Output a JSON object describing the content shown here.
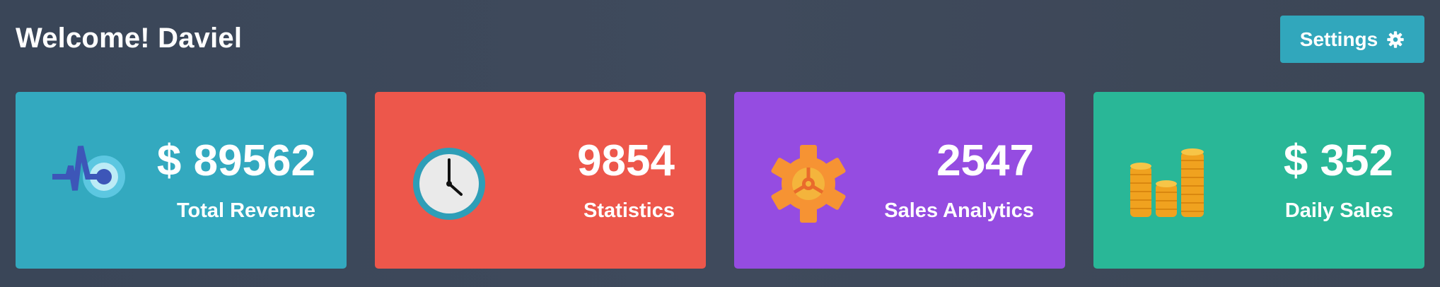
{
  "header": {
    "welcome_text": "Welcome! Daviel",
    "settings_label": "Settings",
    "settings_icon": "gear-icon"
  },
  "cards": [
    {
      "value": "$ 89562",
      "label": "Total Revenue",
      "icon": "pulse-target-icon",
      "color": "#33a9bf"
    },
    {
      "value": "9854",
      "label": "Statistics",
      "icon": "clock-icon",
      "color": "#ed574b"
    },
    {
      "value": "2547",
      "label": "Sales Analytics",
      "icon": "gear-icon",
      "color": "#954ce1"
    },
    {
      "value": "$ 352",
      "label": "Daily Sales",
      "icon": "coin-stacks-icon",
      "color": "#29b797"
    }
  ]
}
